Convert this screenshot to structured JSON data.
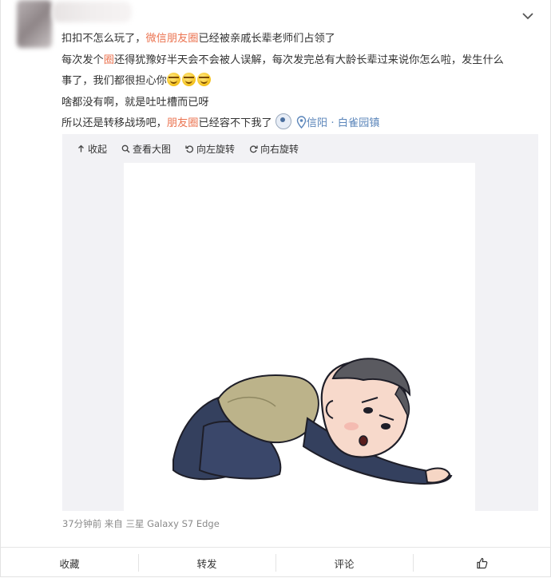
{
  "post": {
    "line1": {
      "a": "扣扣不怎么玩了，",
      "b": "微信朋友圈",
      "c": "已经被亲戚长辈老师们占领了"
    },
    "line2": {
      "a": "每次发个",
      "b": "圈",
      "c": "还得犹豫好半天会不会被人误解，每次发完总有大龄长辈过来说你怎么啦，发生什么"
    },
    "line3": {
      "a": "事了，我们都很担心你"
    },
    "line4": {
      "a": "啥都没有啊，就是吐吐槽而已呀"
    },
    "line5": {
      "a": "所以还是转移战场吧，",
      "b": "朋友圈",
      "c": "已经容不下我了",
      "loc1": "信阳",
      "sep": " · ",
      "loc2": "白雀园镇"
    }
  },
  "media_toolbar": {
    "collapse": "收起",
    "view_large": "查看大图",
    "rotate_left": "向左旋转",
    "rotate_right": "向右旋转"
  },
  "meta": {
    "text": "37分钟前 来自 三星 Galaxy S7 Edge"
  },
  "actions": {
    "favorite": "收藏",
    "repost": "转发",
    "comment": "评论"
  },
  "icons": [
    "chevron-down-icon",
    "laugh-cry-emoji-icon",
    "avatar-sticker-icon",
    "location-pin-icon",
    "arrow-up-icon",
    "magnifier-icon",
    "rotate-left-icon",
    "rotate-right-icon",
    "thumbs-up-icon"
  ],
  "colors": {
    "highlight": "#eb7350",
    "link": "#5d87bb",
    "muted": "#8a8a8a"
  }
}
